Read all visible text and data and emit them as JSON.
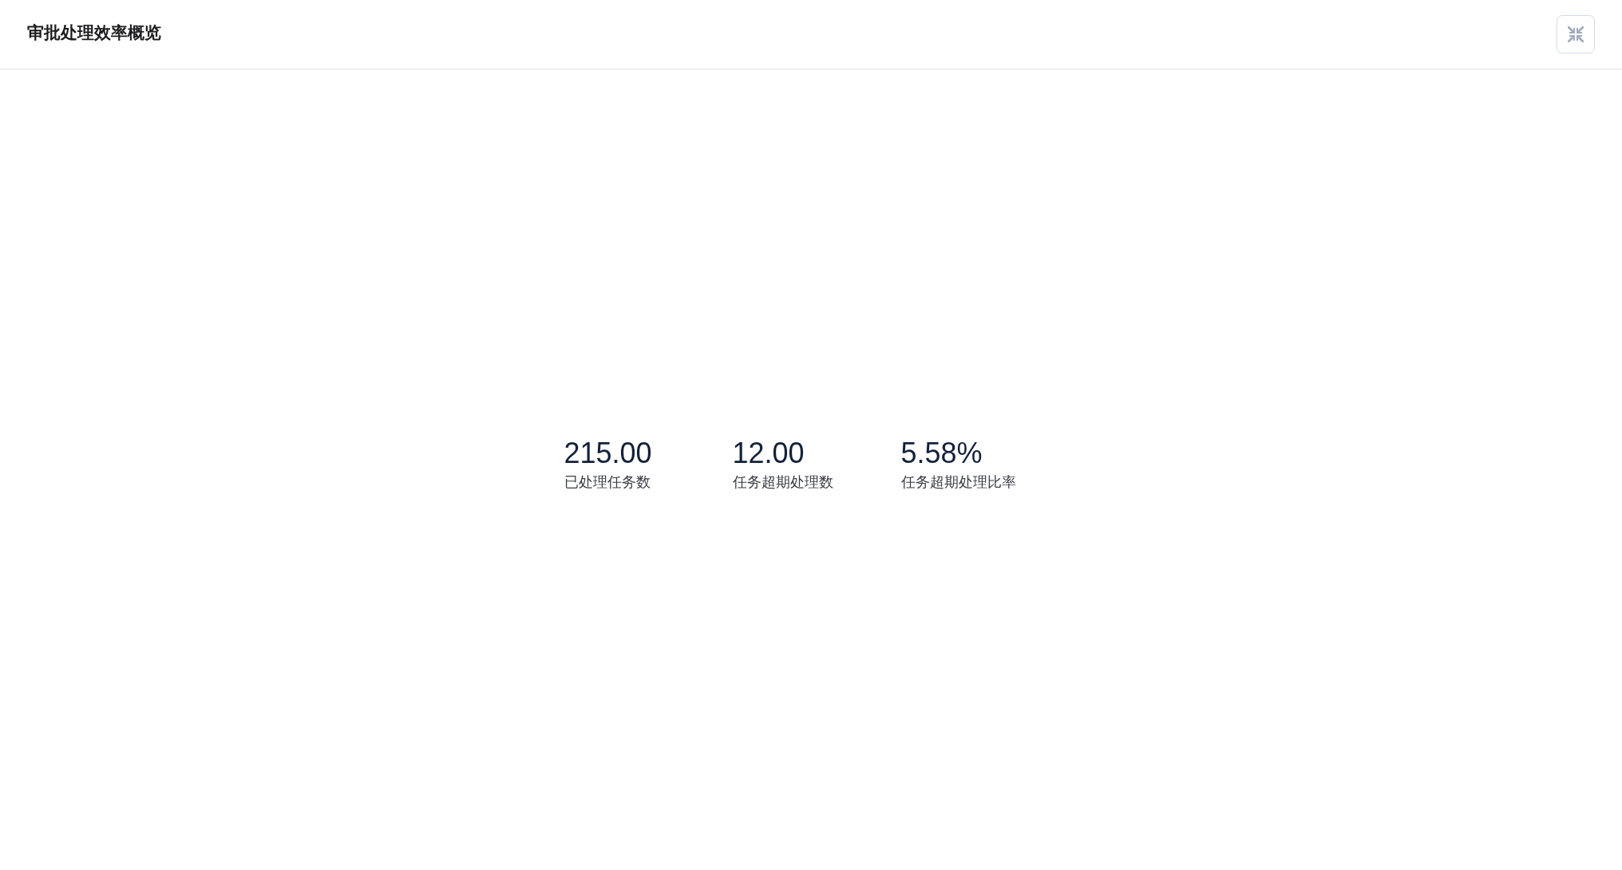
{
  "header": {
    "title": "审批处理效率概览"
  },
  "stats": [
    {
      "value": "215.00",
      "label": "已处理任务数"
    },
    {
      "value": "12.00",
      "label": "任务超期处理数"
    },
    {
      "value": "5.58%",
      "label": "任务超期处理比率"
    }
  ]
}
